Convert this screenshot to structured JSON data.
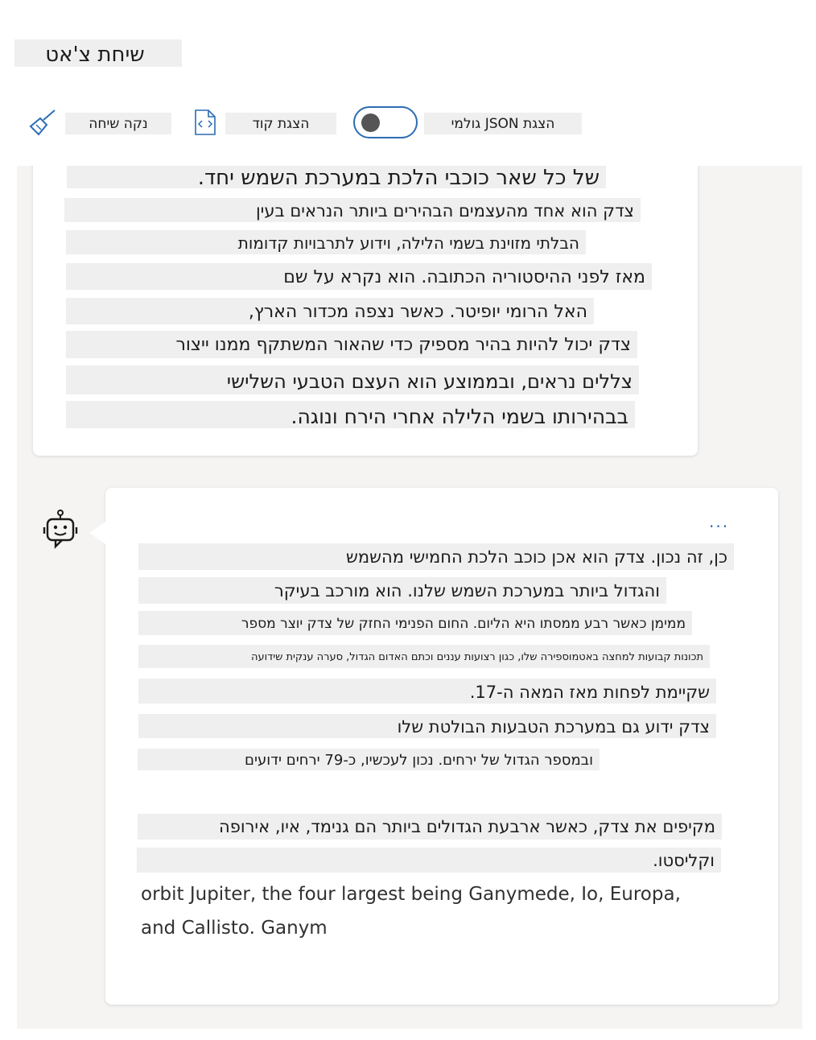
{
  "header": {
    "title": "שיחת צ'אט"
  },
  "toolbar": {
    "clear_label": "נקה שיחה",
    "show_code_label": "הצגת קוד",
    "raw_json_label": "הצגת JSON גולמי",
    "raw_json_enabled": false
  },
  "user_message": {
    "lines": [
      "של כל שאר כוכבי הלכת במערכת השמש יחד.",
      "צדק הוא אחד מהעצמים הבהירים ביותר הנראים בעין",
      "הבלתי מזוינת בשמי הלילה, וידוע לתרבויות קדומות",
      "מאז לפני ההיסטוריה הכתובה. הוא נקרא על שם",
      "האל הרומי יופיטר. כאשר נצפה מכדור הארץ,",
      "צדק יכול להיות בהיר מספיק כדי שהאור המשתקף ממנו ייצור",
      "צללים נראים, ובממוצע הוא העצם הטבעי השלישי",
      "בבהירותו בשמי הלילה אחרי הירח ונוגה."
    ]
  },
  "bot_message": {
    "more_label": "...",
    "lines": [
      "כן, זה נכון. צדק הוא אכן כוכב הלכת החמישי מהשמש",
      "והגדול ביותר במערכת השמש שלנו. הוא מורכב בעיקר",
      "ממימן כאשר רבע ממסתו היא הליום. החום הפנימי החזק של צדק יוצר מספר",
      "תכונות קבועות למחצה באטמוספירה שלו, כגון רצועות עננים וכתם האדום הגדול, סערה ענקית שידועה",
      "שקיימת לפחות מאז המאה ה-17.",
      "צדק ידוע גם במערכת הטבעות הבולטת שלו",
      "ובמספר הגדול של ירחים. נכון לעכשיו, כ-79 ירחים ידועים",
      "מקיפים את צדק, כאשר ארבעת הגדולים ביותר הם גנימד, איו, אירופה",
      "וקליסטו."
    ],
    "english_lines": [
      "orbit Jupiter, the four largest being Ganymede, Io, Europa,",
      "and Callisto. Ganym"
    ]
  }
}
